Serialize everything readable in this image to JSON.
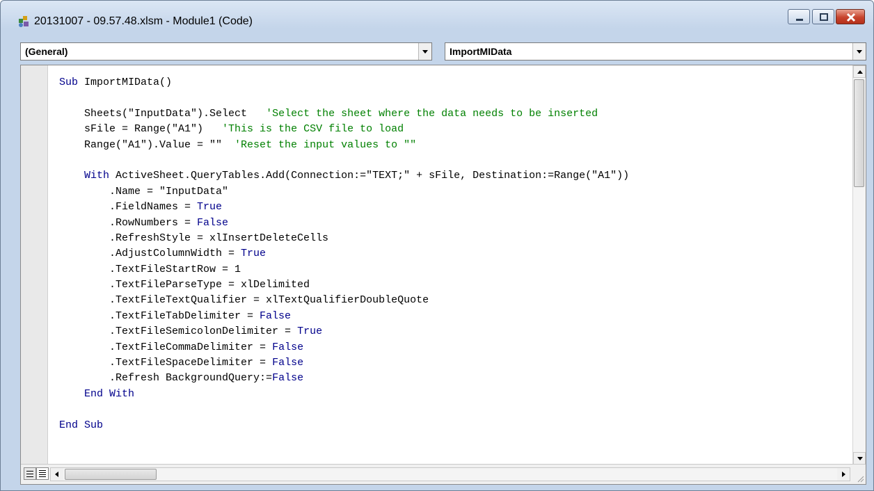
{
  "window": {
    "title": "20131007 - 09.57.48.xlsm - Module1 (Code)"
  },
  "object_combo": {
    "selected": "(General)"
  },
  "procedure_combo": {
    "selected": "ImportMIData"
  },
  "colors": {
    "keyword": "#00008b",
    "comment": "#008000",
    "close_button": "#c7442d"
  },
  "code_lines": [
    [
      {
        "t": "Sub ",
        "c": "kw"
      },
      {
        "t": "ImportMIData()",
        "c": ""
      }
    ],
    [],
    [
      {
        "t": "    Sheets(\"InputData\").Select   ",
        "c": ""
      },
      {
        "t": "'Select the sheet where the data needs to be inserted",
        "c": "cm"
      }
    ],
    [
      {
        "t": "    sFile = Range(\"A1\")   ",
        "c": ""
      },
      {
        "t": "'This is the CSV file to load",
        "c": "cm"
      }
    ],
    [
      {
        "t": "    Range(\"A1\").Value = \"\"  ",
        "c": ""
      },
      {
        "t": "'Reset the input values to \"\"",
        "c": "cm"
      }
    ],
    [],
    [
      {
        "t": "    ",
        "c": ""
      },
      {
        "t": "With ",
        "c": "kw"
      },
      {
        "t": "ActiveSheet.QueryTables.Add(Connection:=\"TEXT;\" + sFile, Destination:=Range(\"A1\"))",
        "c": ""
      }
    ],
    [
      {
        "t": "        .Name = \"InputData\"",
        "c": ""
      }
    ],
    [
      {
        "t": "        .FieldNames = ",
        "c": ""
      },
      {
        "t": "True",
        "c": "kw"
      }
    ],
    [
      {
        "t": "        .RowNumbers = ",
        "c": ""
      },
      {
        "t": "False",
        "c": "kw"
      }
    ],
    [
      {
        "t": "        .RefreshStyle = xlInsertDeleteCells",
        "c": ""
      }
    ],
    [
      {
        "t": "        .AdjustColumnWidth = ",
        "c": ""
      },
      {
        "t": "True",
        "c": "kw"
      }
    ],
    [
      {
        "t": "        .TextFileStartRow = 1",
        "c": ""
      }
    ],
    [
      {
        "t": "        .TextFileParseType = xlDelimited",
        "c": ""
      }
    ],
    [
      {
        "t": "        .TextFileTextQualifier = xlTextQualifierDoubleQuote",
        "c": ""
      }
    ],
    [
      {
        "t": "        .TextFileTabDelimiter = ",
        "c": ""
      },
      {
        "t": "False",
        "c": "kw"
      }
    ],
    [
      {
        "t": "        .TextFileSemicolonDelimiter = ",
        "c": ""
      },
      {
        "t": "True",
        "c": "kw"
      }
    ],
    [
      {
        "t": "        .TextFileCommaDelimiter = ",
        "c": ""
      },
      {
        "t": "False",
        "c": "kw"
      }
    ],
    [
      {
        "t": "        .TextFileSpaceDelimiter = ",
        "c": ""
      },
      {
        "t": "False",
        "c": "kw"
      }
    ],
    [
      {
        "t": "        .Refresh BackgroundQuery:=",
        "c": ""
      },
      {
        "t": "False",
        "c": "kw"
      }
    ],
    [
      {
        "t": "    ",
        "c": ""
      },
      {
        "t": "End With",
        "c": "kw"
      }
    ],
    [],
    [
      {
        "t": "End Sub",
        "c": "kw"
      }
    ]
  ]
}
